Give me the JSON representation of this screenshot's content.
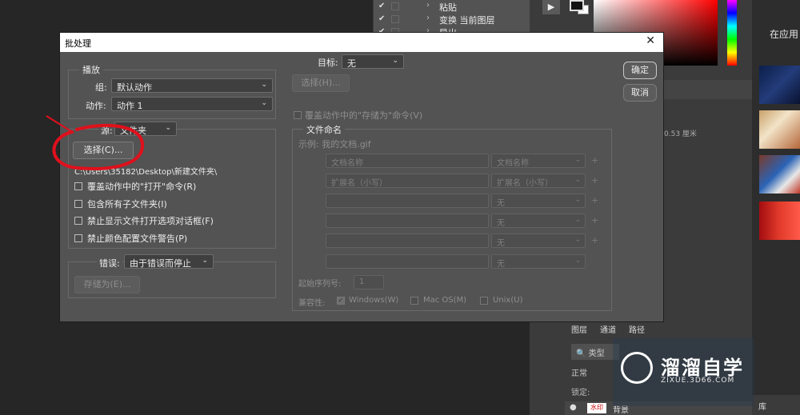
{
  "background": {
    "actions_panel": {
      "rows": [
        {
          "label": "粘贴"
        },
        {
          "label": "变换 当前图层"
        },
        {
          "label": "导出"
        }
      ],
      "check_glyph": "✔",
      "arrow_glyph": "›"
    },
    "play_glyph": "▶",
    "right_panel_title": "在应用",
    "ruler_text": "0.53 厘米",
    "layers_panel": {
      "tabs": [
        "图层",
        "通道",
        "路径"
      ],
      "search_placeholder": "🔍 类型",
      "mode": "正常",
      "lock_label": "锁定:",
      "layer_name": "背景",
      "layer_thumb_text": "水印"
    },
    "library_tab": "库",
    "watermark": {
      "brand": "溜溜自学",
      "url": "ZIXUE.3D66.COM"
    }
  },
  "dialog": {
    "title": "批处理",
    "close_glyph": "✕",
    "ok_label": "确定",
    "cancel_label": "取消",
    "play": {
      "legend": "播放",
      "set_label": "组:",
      "set_value": "默认动作",
      "action_label": "动作:",
      "action_value": "动作 1"
    },
    "source": {
      "label": "源:",
      "value": "文件夹",
      "choose_label": "选择(C)...",
      "path": "C:\\Users\\35182\\Desktop\\新建文件夹\\",
      "options": [
        "覆盖动作中的\"打开\"命令(R)",
        "包含所有子文件夹(I)",
        "禁止显示文件打开选项对话框(F)",
        "禁止颜色配置文件警告(P)"
      ]
    },
    "errors": {
      "label": "错误:",
      "value": "由于错误而停止",
      "save_as_label": "存储为(E)..."
    },
    "destination": {
      "label": "目标:",
      "value": "无",
      "choose_label": "选择(H)...",
      "override_label": "覆盖动作中的\"存储为\"命令(V)"
    },
    "file_naming": {
      "legend": "文件命名",
      "example": "示例: 我的文档.gif",
      "rows": [
        {
          "left": "文档名称",
          "right": "文档名称"
        },
        {
          "left": "扩展名（小写）",
          "right": "扩展名（小写）"
        },
        {
          "left": "",
          "right": "无"
        },
        {
          "left": "",
          "right": "无"
        },
        {
          "left": "",
          "right": "无"
        },
        {
          "left": "",
          "right": "无"
        }
      ],
      "serial_label": "起始序列号:",
      "serial_value": "1",
      "compat_label": "兼容性:",
      "compat": [
        {
          "label": "Windows(W)",
          "checked": true
        },
        {
          "label": "Mac OS(M)",
          "checked": false
        },
        {
          "label": "Unix(U)",
          "checked": false
        }
      ]
    }
  },
  "colors": {
    "annotation_red": "#e0101c",
    "dialog_bg": "#535353"
  }
}
